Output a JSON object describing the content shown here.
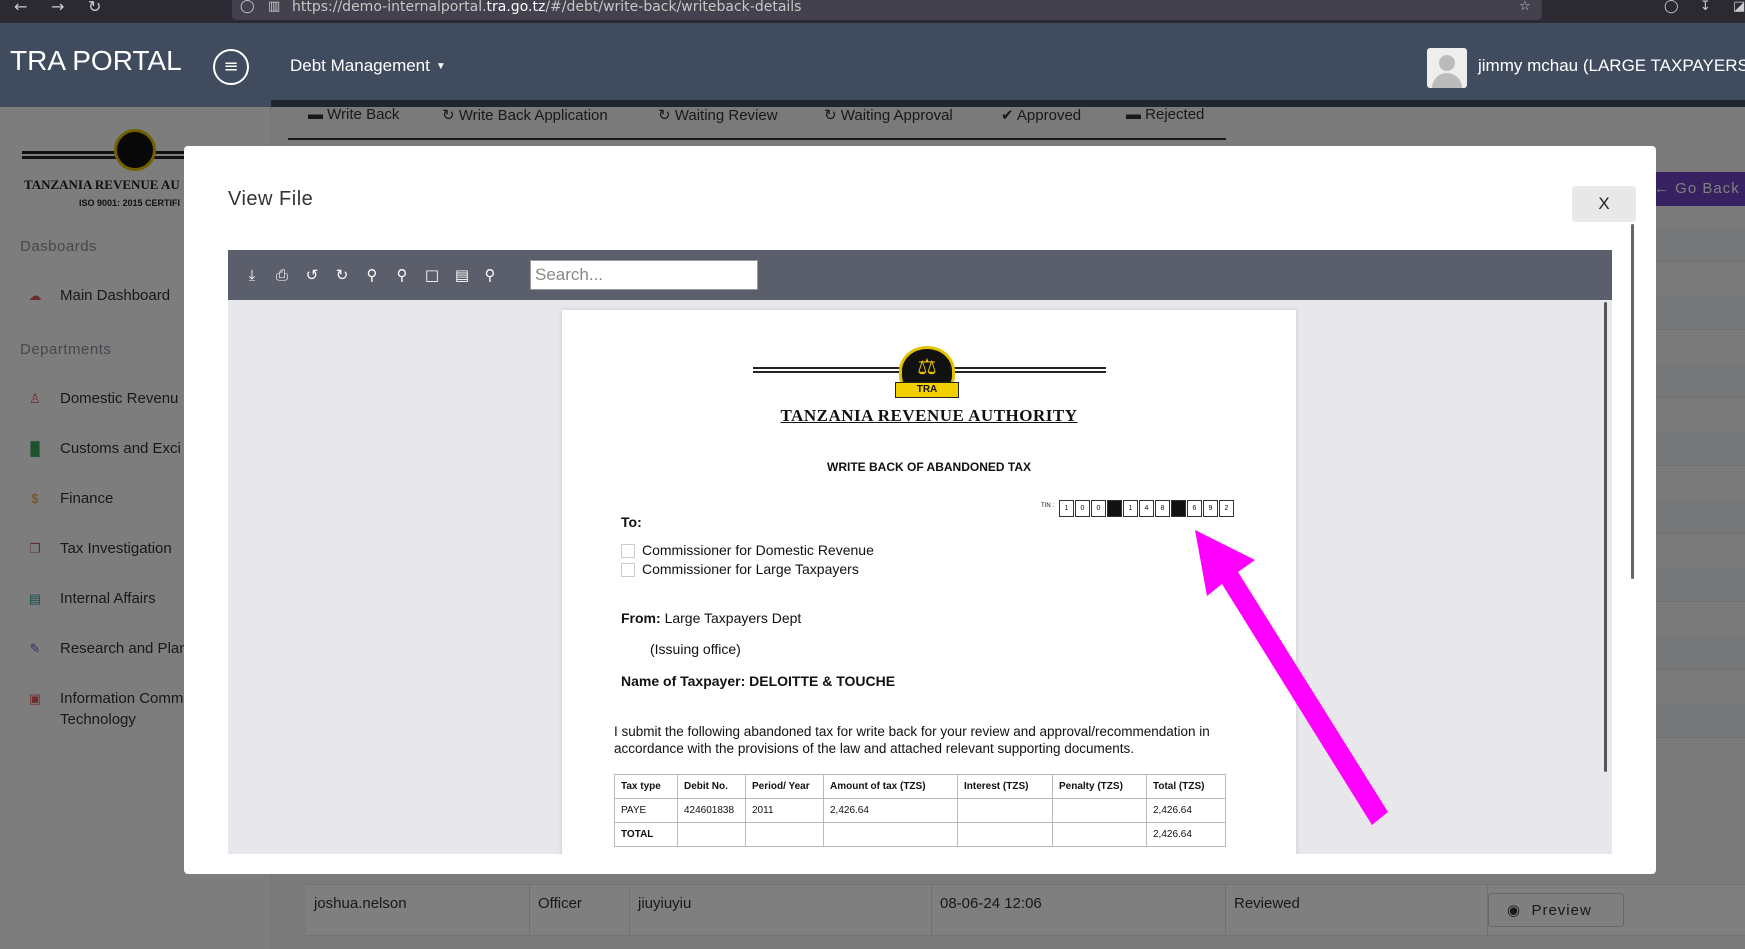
{
  "browser": {
    "url_prefix": "https://demo-internalportal.",
    "url_domain": "tra.go.tz",
    "url_suffix": "/#/debt/write-back/writeback-details"
  },
  "header": {
    "brand": "TRA PORTAL",
    "menu_label": "Debt Management",
    "user": "jimmy mchau (LARGE TAXPAYERS"
  },
  "sidebar": {
    "logo_text": "TANZANIA REVENUE AU",
    "logo_sub": "ISO 9001: 2015 CERTIFI",
    "section_dashboards": "Dasboards",
    "section_departments": "Departments",
    "items": [
      {
        "label": "Main Dashboard",
        "icon": "dashboard-icon"
      },
      {
        "label": "Domestic Revenu",
        "icon": "user-icon"
      },
      {
        "label": "Customs and Exci",
        "icon": "chart-icon"
      },
      {
        "label": "Finance",
        "icon": "dollar-icon"
      },
      {
        "label": "Tax Investigation",
        "icon": "copy-icon"
      },
      {
        "label": "Internal Affairs",
        "icon": "briefcase-icon"
      },
      {
        "label": "Research and Plan",
        "icon": "edit-icon"
      },
      {
        "label": "Information Comm",
        "label2": "Technology",
        "icon": "tablet-icon"
      }
    ]
  },
  "tabs": [
    {
      "label": "Write Back",
      "icon": "card-icon"
    },
    {
      "label": "Write Back Application",
      "icon": "refresh-icon"
    },
    {
      "label": "Waiting Review",
      "icon": "refresh-icon"
    },
    {
      "label": "Waiting Approval",
      "icon": "refresh-icon"
    },
    {
      "label": "Approved",
      "icon": "check-icon"
    },
    {
      "label": "Rejected",
      "icon": "minus-icon"
    }
  ],
  "go_back": "Go Back",
  "table_row": {
    "user": "joshua.nelson",
    "role": "Officer",
    "comment": "jiuyiuyiu",
    "date": "08-06-24 12:06",
    "status": "Reviewed",
    "action": "Preview"
  },
  "modal": {
    "title": "View File",
    "close": "X",
    "search_placeholder": "Search..."
  },
  "document": {
    "org": "TANZANIA REVENUE AUTHORITY",
    "seal_text": "TRA",
    "heading": "WRITE BACK OF ABANDONED TAX",
    "tin_label": "TIN :",
    "tin_digits": [
      "1",
      "0",
      "0",
      "",
      "1",
      "4",
      "8",
      "",
      "6",
      "9",
      "2"
    ],
    "to": "To:",
    "options": [
      "Commissioner for Domestic Revenue",
      "Commissioner for Large Taxpayers"
    ],
    "from_label": "From:",
    "from_value": "Large Taxpayers Dept",
    "issuing": "(Issuing office)",
    "taxpayer": "Name of Taxpayer: DELOITTE & TOUCHE",
    "body": "I submit the following abandoned tax for write back for your review and approval/recommendation in accordance with the provisions of the law and attached relevant supporting documents.",
    "table": {
      "headers": [
        "Tax type",
        "Debit No.",
        "Period/ Year",
        "Amount of tax (TZS)",
        "Interest (TZS)",
        "Penalty (TZS)",
        "Total (TZS)"
      ],
      "rows": [
        [
          "PAYE",
          "424601838",
          "2011",
          "2,426.64",
          "",
          "",
          "2,426.64"
        ],
        [
          "TOTAL",
          "",
          "",
          "",
          "",
          "",
          "2,426.64"
        ]
      ]
    }
  },
  "annotation_color": "#ff00ff"
}
